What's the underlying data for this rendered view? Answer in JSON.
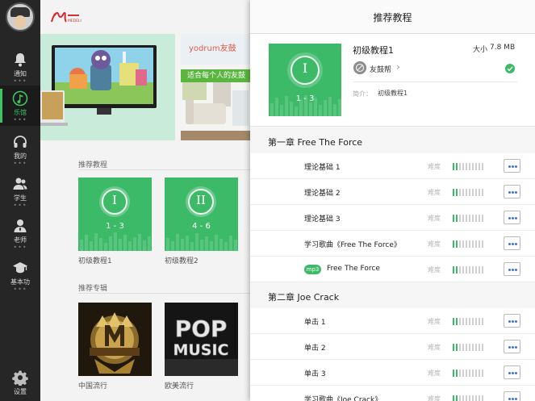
{
  "sidebar": {
    "items": [
      {
        "label": "通知",
        "icon": "bell-icon",
        "dots": "•••"
      },
      {
        "label": "乐馆",
        "icon": "music-note-icon",
        "dots": "•••",
        "active": true
      },
      {
        "label": "我的",
        "icon": "headphones-icon",
        "dots": "•••"
      },
      {
        "label": "学生",
        "icon": "students-icon",
        "dots": "•••"
      },
      {
        "label": "老师",
        "icon": "teacher-icon",
        "dots": "•••"
      },
      {
        "label": "基本功",
        "icon": "graduation-cap-icon",
        "dots": "•••"
      }
    ],
    "settings_label": "设置"
  },
  "main": {
    "logo_text": "MEDELI",
    "banner2_brand": "yodrum友鼓",
    "banner2_slogan": "适合每个人的友鼓",
    "tutorials_title": "推荐教程",
    "tutorials": [
      {
        "roman": "I",
        "range": "1 - 3",
        "label": "初级教程1"
      },
      {
        "roman": "II",
        "range": "4 - 6",
        "label": "初级教程2"
      }
    ],
    "albums_title": "推荐专辑",
    "albums": [
      {
        "label": "中国流行"
      },
      {
        "label": "欧美流行",
        "cover_text": [
          "POP",
          "MUSIC"
        ]
      }
    ]
  },
  "overlay": {
    "title": "推荐教程",
    "detail": {
      "roman": "I",
      "range": "1 - 3",
      "name": "初级教程1",
      "size_label": "大小",
      "size": "7.8 MB",
      "author": "友鼓帮",
      "intro_label": "简介：",
      "intro": "初级教程1"
    },
    "difficulty_label": "难度",
    "chapters": [
      {
        "title": "第一章 Free The Force",
        "lessons": [
          {
            "name": "理论基础 1",
            "level": 0.2
          },
          {
            "name": "理论基础 2",
            "level": 0.2
          },
          {
            "name": "理论基础 3",
            "level": 0.2
          },
          {
            "name": "学习歌曲《Free The Force》",
            "level": 0.2
          },
          {
            "name": "Free The Force",
            "badge": "mp3",
            "level": 0.2
          }
        ]
      },
      {
        "title": "第二章 Joe Crack",
        "lessons": [
          {
            "name": "单击 1",
            "level": 0.2
          },
          {
            "name": "单击 2",
            "level": 0.2
          },
          {
            "name": "单击 3",
            "level": 0.2
          },
          {
            "name": "学习歌曲《Joe Crack》",
            "level": 0.2
          }
        ]
      }
    ]
  },
  "colors": {
    "accent": "#3cba68",
    "sidebar": "#262626",
    "link": "#3a7bd5"
  }
}
